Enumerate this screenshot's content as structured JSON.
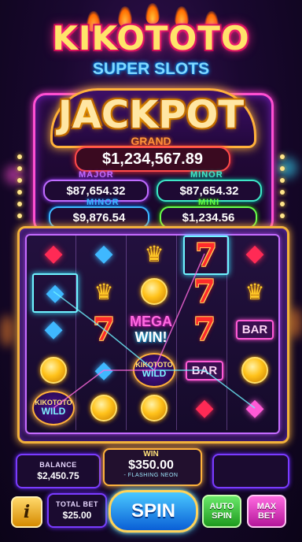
{
  "title": {
    "main": "KIKOTOTO",
    "sub": "SUPER SLOTS"
  },
  "jackpot": {
    "title": "JACKPOT",
    "grand": {
      "label": "GRAND",
      "value": "$1,234,567.89"
    },
    "major": {
      "label": "MAJOR",
      "value": "$87,654.32",
      "color": "#c06cff"
    },
    "minor_top": {
      "label": "MINOR",
      "value": "$87,654.32",
      "color": "#3fe8c8"
    },
    "minor": {
      "label": "MINOR",
      "value": "$9,876.54",
      "color": "#3fb8ff"
    },
    "mini": {
      "label": "MINI",
      "value": "$1,234.56",
      "color": "#6aff4a"
    }
  },
  "reels": {
    "mega_win": [
      "MEGA",
      "WIN!"
    ],
    "wild": {
      "line1": "KIKOTOTO",
      "line2": "WILD"
    },
    "bar_label": "BAR",
    "symbols": [
      [
        "gem-red",
        "gem-blue",
        "crown",
        "seven",
        "gem-red"
      ],
      [
        "gem-blue",
        "crown",
        "coin",
        "seven",
        "crown"
      ],
      [
        "gem-blue",
        "seven",
        "mega-win",
        "seven",
        "bar"
      ],
      [
        "coin",
        "gem-blue",
        "wild",
        "bar",
        "coin"
      ],
      [
        "wild",
        "coin",
        "coin",
        "gem-red",
        "gem-pink"
      ]
    ]
  },
  "panel": {
    "balance": {
      "label": "BALANCE",
      "value": "$2,450.75"
    },
    "win": {
      "label": "WIN",
      "value": "$350.00",
      "note": "- FLASHING NEON"
    },
    "total_bet": {
      "label": "TOTAL BET",
      "value": "$25.00"
    },
    "buttons": {
      "info": "i",
      "spin": "SPIN",
      "auto": [
        "AUTO",
        "SPIN"
      ],
      "max": [
        "MAX",
        "BET"
      ]
    }
  },
  "colors": {
    "accent_gold": "#ffb13b",
    "neon_pink": "#ff4fd2",
    "neon_cyan": "#39e2ff"
  }
}
